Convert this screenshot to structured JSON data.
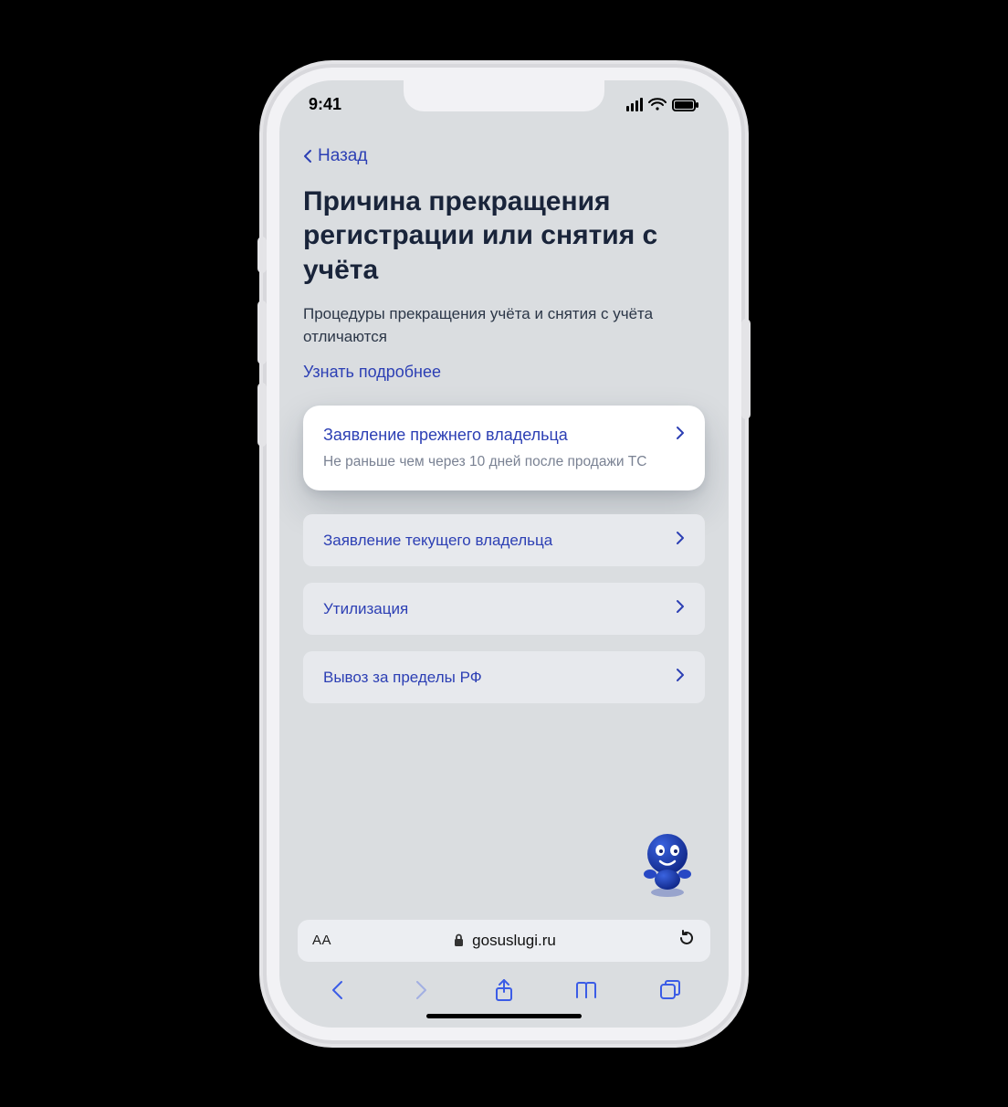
{
  "status": {
    "time": "9:41"
  },
  "nav": {
    "back": "Назад"
  },
  "page": {
    "title": "Причина прекращения регистрации или снятия с учёта",
    "subtitle": "Процедуры прекращения учёта и снятия с учёта отличаются",
    "more": "Узнать подробнее"
  },
  "options": [
    {
      "label": "Заявление прежнего владельца",
      "desc": "Не раньше чем через 10 дней после продажи ТС",
      "highlight": true
    },
    {
      "label": "Заявление текущего владельца"
    },
    {
      "label": "Утилизация"
    },
    {
      "label": "Вывоз за пределы РФ"
    }
  ],
  "browser": {
    "aa": "AA",
    "host": "gosuslugi.ru"
  }
}
